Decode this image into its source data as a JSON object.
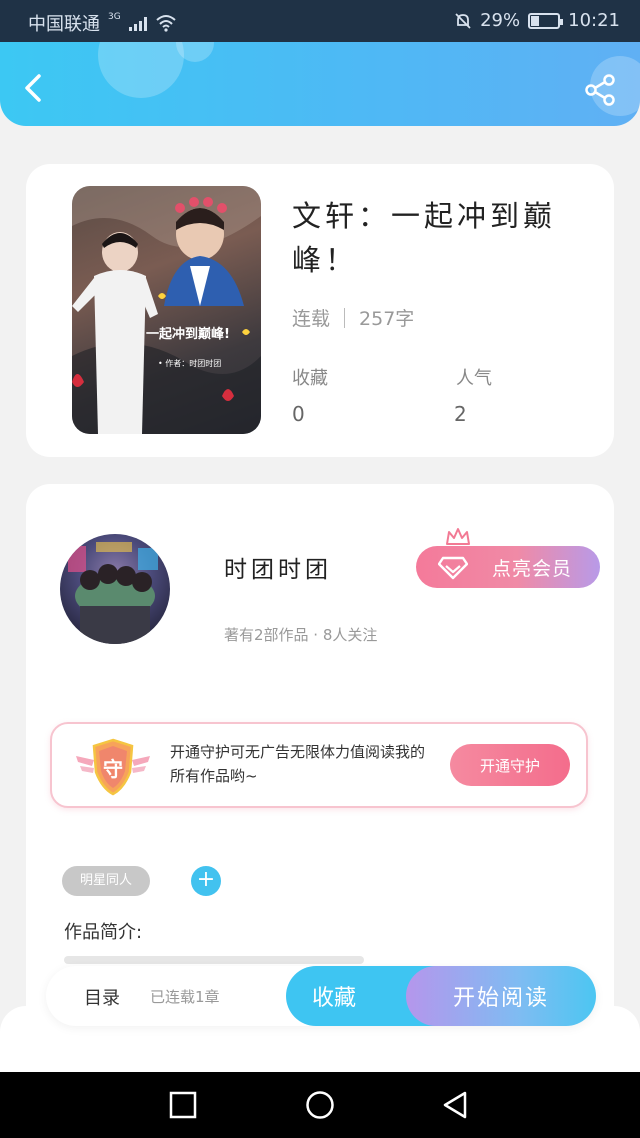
{
  "status_bar": {
    "carrier": "中国联通",
    "network": "3G",
    "battery": "29%",
    "battery_level": 0.29,
    "time": "10:21"
  },
  "header": {
    "back_icon": "chevron-left-icon",
    "share_icon": "share-icon"
  },
  "book": {
    "title": "文轩：一起冲到巅峰！",
    "status": "连载",
    "word_count": "257字",
    "favorites_label": "收藏",
    "favorites_value": "0",
    "popularity_label": "人气",
    "popularity_value": "2"
  },
  "author": {
    "name": "时团时团",
    "subtitle": "著有2部作品 · 8人关注",
    "vip_button": "点亮会员"
  },
  "guard": {
    "badge": "守",
    "text": "开通守护可无广告无限体力值阅读我的所有作品哟~",
    "button": "开通守护"
  },
  "tags": {
    "items": [
      "明星同人"
    ],
    "add": "+"
  },
  "intro": {
    "label": "作品简介:"
  },
  "bottom_bar": {
    "toc_label": "目录",
    "toc_status": "已连载1章",
    "collect_button": "收藏",
    "read_button": "开始阅读"
  },
  "colors": {
    "header_blue": "#3cc8f3",
    "accent_pink": "#f47a9a",
    "accent_purple": "#b596ec",
    "cyan": "#3ec5f2"
  }
}
